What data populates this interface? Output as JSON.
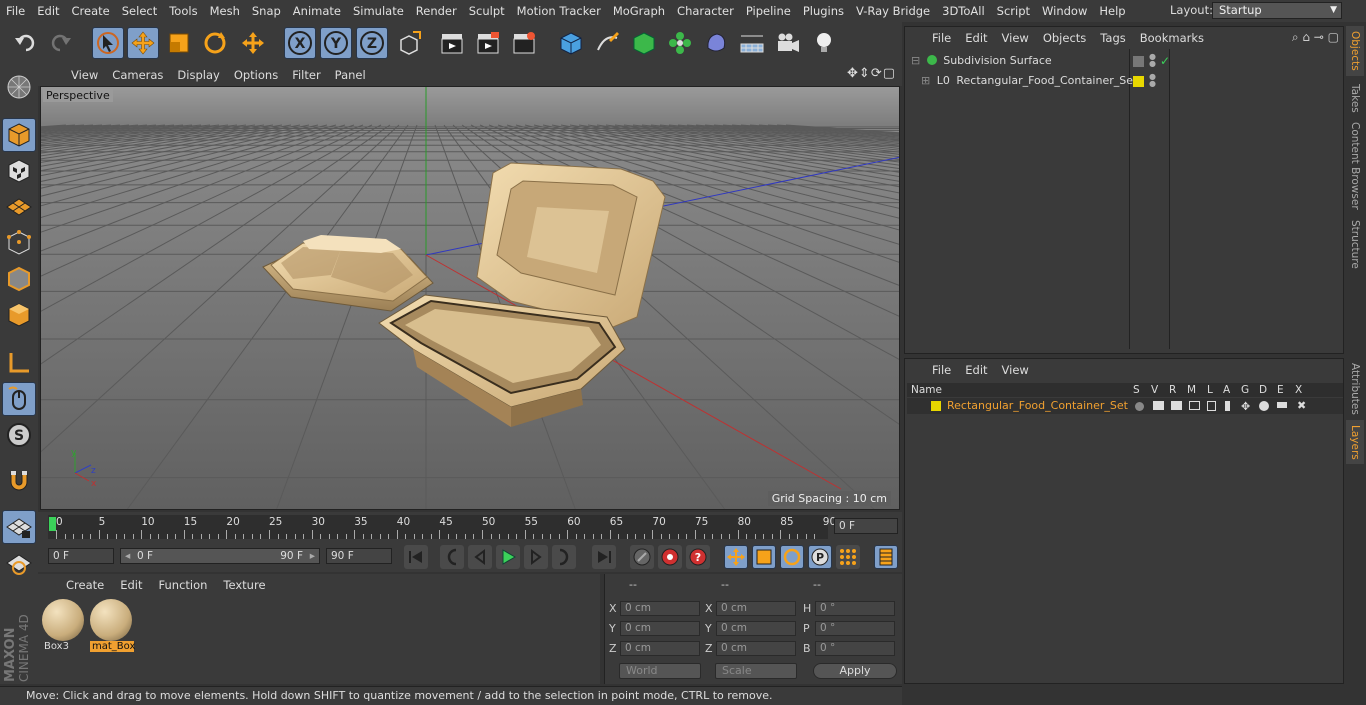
{
  "menubar": {
    "items": [
      "File",
      "Edit",
      "Create",
      "Select",
      "Tools",
      "Mesh",
      "Snap",
      "Animate",
      "Simulate",
      "Render",
      "Sculpt",
      "Motion Tracker",
      "MoGraph",
      "Character",
      "Pipeline",
      "Plugins",
      "V-Ray Bridge",
      "3DToAll",
      "Script",
      "Window",
      "Help"
    ],
    "layout_label": "Layout:",
    "layout_value": "Startup"
  },
  "viewport": {
    "menu": [
      "View",
      "Cameras",
      "Display",
      "Options",
      "Filter",
      "Panel"
    ],
    "nav_icons": "✥⇕⟳▢",
    "label": "Perspective",
    "grid_spacing": "Grid Spacing : 10 cm",
    "axis_y": "y",
    "axis_z": "z",
    "axis_x": "x"
  },
  "timeline": {
    "ticks": [
      "0",
      "5",
      "10",
      "15",
      "20",
      "25",
      "30",
      "35",
      "40",
      "45",
      "50",
      "55",
      "60",
      "65",
      "70",
      "75",
      "80",
      "85",
      "90"
    ],
    "current_frame": "0 F"
  },
  "transport": {
    "start_field": "0 F",
    "range_start": "0 F",
    "range_end": "90 F",
    "end_field": "90 F"
  },
  "material_manager": {
    "menu": [
      "Create",
      "Edit",
      "Function",
      "Texture"
    ],
    "materials": [
      {
        "name": "Box3",
        "selected": false
      },
      {
        "name": "mat_Box",
        "selected": true
      }
    ]
  },
  "coordinates": {
    "headers": [
      "--",
      "--",
      "--"
    ],
    "rows": [
      {
        "l1": "X",
        "v1": "0 cm",
        "l2": "X",
        "v2": "0 cm",
        "l3": "H",
        "v3": "0 °"
      },
      {
        "l1": "Y",
        "v1": "0 cm",
        "l2": "Y",
        "v2": "0 cm",
        "l3": "P",
        "v3": "0 °"
      },
      {
        "l1": "Z",
        "v1": "0 cm",
        "l2": "Z",
        "v2": "0 cm",
        "l3": "B",
        "v3": "0 °"
      }
    ],
    "world": "World",
    "scale": "Scale",
    "apply": "Apply"
  },
  "status": {
    "text": "Move: Click and drag to move elements. Hold down SHIFT to quantize movement / add to the selection in point mode, CTRL to remove."
  },
  "object_manager": {
    "menu": [
      "File",
      "Edit",
      "View",
      "Objects",
      "Tags",
      "Bookmarks"
    ],
    "objects": [
      {
        "name": "Subdivision Surface",
        "tag": "✓"
      },
      {
        "name": "Rectangular_Food_Container_Set",
        "tag": ""
      }
    ]
  },
  "layer_manager": {
    "menu": [
      "File",
      "Edit",
      "View"
    ],
    "header_name": "Name",
    "columns": [
      "S",
      "V",
      "R",
      "M",
      "L",
      "A",
      "G",
      "D",
      "E",
      "X"
    ],
    "layers": [
      {
        "name": "Rectangular_Food_Container_Set"
      }
    ]
  },
  "right_tabs": [
    "Objects",
    "Takes",
    "Content Browser",
    "Structure",
    "Attributes",
    "Layers"
  ],
  "brand": {
    "line1": "MAXON",
    "line2": "CINEMA 4D"
  },
  "colors": {
    "accent": "#f0a030",
    "tool_blue": "#7f9fc9",
    "layer_yellow": "#e8d800",
    "x_axis": "#c03030",
    "y_axis": "#30a030",
    "z_axis": "#3040c0"
  }
}
